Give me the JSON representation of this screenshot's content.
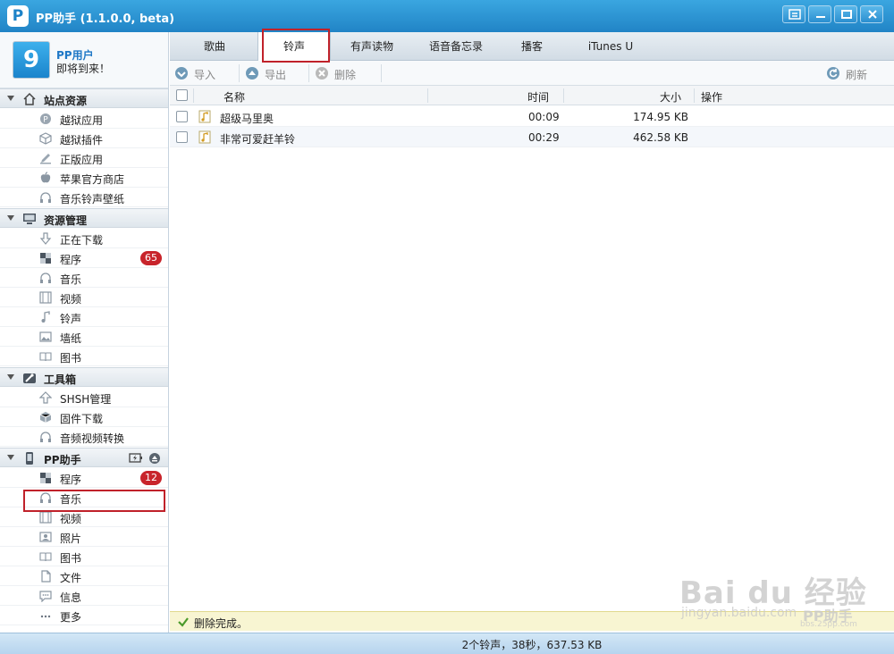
{
  "window": {
    "title": "PP助手 (1.1.0.0, beta)",
    "logo_letter": "P"
  },
  "user": {
    "name": "PP用户",
    "subtitle": "即将到来！"
  },
  "sidebar": {
    "sections": [
      {
        "label": "站点资源",
        "items": [
          {
            "label": "越狱应用"
          },
          {
            "label": "越狱插件"
          },
          {
            "label": "正版应用"
          },
          {
            "label": "苹果官方商店"
          },
          {
            "label": "音乐铃声壁纸"
          }
        ]
      },
      {
        "label": "资源管理",
        "items": [
          {
            "label": "正在下载"
          },
          {
            "label": "程序",
            "badge": "65"
          },
          {
            "label": "音乐"
          },
          {
            "label": "视频"
          },
          {
            "label": "铃声"
          },
          {
            "label": "墙纸"
          },
          {
            "label": "图书"
          }
        ]
      },
      {
        "label": "工具箱",
        "items": [
          {
            "label": "SHSH管理"
          },
          {
            "label": "固件下载"
          },
          {
            "label": "音频视频转换"
          }
        ]
      },
      {
        "label": "PP助手",
        "items": [
          {
            "label": "程序",
            "badge": "12"
          },
          {
            "label": "音乐"
          },
          {
            "label": "视频"
          },
          {
            "label": "照片"
          },
          {
            "label": "图书"
          },
          {
            "label": "文件"
          },
          {
            "label": "信息"
          },
          {
            "label": "更多"
          }
        ]
      }
    ]
  },
  "tabs": [
    {
      "label": "歌曲"
    },
    {
      "label": "铃声",
      "active": true
    },
    {
      "label": "有声读物"
    },
    {
      "label": "语音备忘录"
    },
    {
      "label": "播客"
    },
    {
      "label": "iTunes U"
    }
  ],
  "toolbar": {
    "import_label": "导入",
    "export_label": "导出",
    "delete_label": "删除",
    "refresh_label": "刷新"
  },
  "table": {
    "columns": {
      "name": "名称",
      "time": "时间",
      "size": "大小",
      "action": "操作"
    },
    "rows": [
      {
        "name": "超级马里奥",
        "time": "00:09",
        "size": "174.95 KB"
      },
      {
        "name": "非常可爱赶羊铃",
        "time": "00:29",
        "size": "462.58 KB"
      }
    ]
  },
  "status": {
    "message": "删除完成。"
  },
  "summary": "2个铃声，38秒，637.53 KB",
  "watermark": {
    "text": "Bai du 经验",
    "url": "jingyan.baidu.com",
    "brand": "PP助手",
    "site": "bbs.25pp.com"
  },
  "colors": {
    "accent": "#2184c6",
    "badge": "#c8242b",
    "highlight": "#c0212a"
  }
}
